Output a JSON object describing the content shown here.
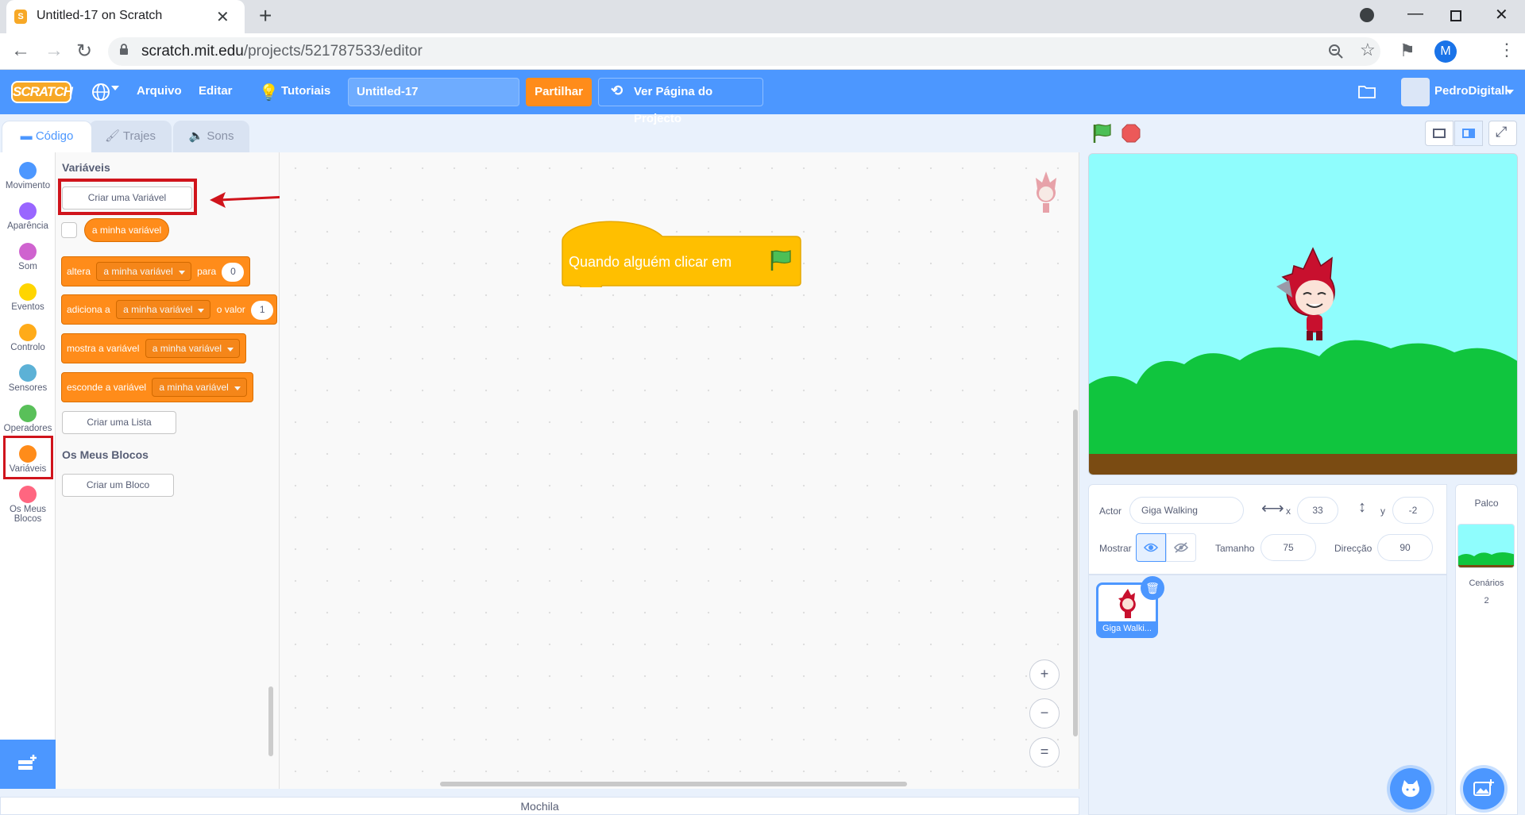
{
  "browser": {
    "tab_title": "Untitled-17 on Scratch",
    "tab_favicon_text": "S",
    "url_domain": "scratch.mit.edu",
    "url_path": "/projects/521787533/editor",
    "profile_initial": "M"
  },
  "menubar": {
    "logo": "SCRATCH",
    "file": "Arquivo",
    "edit": "Editar",
    "tutorials": "Tutoriais",
    "project_title": "Untitled-17",
    "share": "Partilhar",
    "project_page": "Ver Página do Projecto",
    "username": "PedroDigitall"
  },
  "editor_tabs": {
    "code": "Código",
    "costumes": "Trajes",
    "sounds": "Sons"
  },
  "categories": [
    {
      "label": "Movimento",
      "color": "#4c97ff"
    },
    {
      "label": "Aparência",
      "color": "#9966ff"
    },
    {
      "label": "Som",
      "color": "#cf63cf"
    },
    {
      "label": "Eventos",
      "color": "#ffd500"
    },
    {
      "label": "Controlo",
      "color": "#ffab19"
    },
    {
      "label": "Sensores",
      "color": "#5cb1d6"
    },
    {
      "label": "Operadores",
      "color": "#59c059"
    },
    {
      "label": "Variáveis",
      "color": "#ff8c1a"
    },
    {
      "label": "Os Meus Blocos",
      "color": "#ff6680"
    }
  ],
  "palette": {
    "variables_title": "Variáveis",
    "create_variable": "Criar uma Variável",
    "my_variable": "a minha variável",
    "set_block": {
      "prefix": "altera",
      "var": "a minha variável",
      "mid": "para",
      "value": "0"
    },
    "change_block": {
      "prefix": "adiciona a",
      "var": "a minha variável",
      "mid": "o valor",
      "value": "1"
    },
    "show_block": {
      "prefix": "mostra a variável",
      "var": "a minha variável"
    },
    "hide_block": {
      "prefix": "esconde a variável",
      "var": "a minha variável"
    },
    "create_list": "Criar uma Lista",
    "my_blocks_title": "Os Meus Blocos",
    "create_block": "Criar um Bloco"
  },
  "code": {
    "hat_label": "Quando alguém clicar em",
    "zoom_in": "+",
    "zoom_out": "−",
    "zoom_reset": "="
  },
  "backpack": "Mochila",
  "sprite_info": {
    "actor_label": "Actor",
    "actor_name": "Giga Walking",
    "x_label": "x",
    "x_value": "33",
    "y_label": "y",
    "y_value": "-2",
    "show_label": "Mostrar",
    "size_label": "Tamanho",
    "size_value": "75",
    "direction_label": "Direcção",
    "direction_value": "90"
  },
  "sprite_list": [
    {
      "label": "Giga Walki..."
    }
  ],
  "stage_panel": {
    "title": "Palco",
    "backdrops_label": "Cenários",
    "backdrops_count": "2"
  },
  "colors": {
    "scratch_blue": "#4c97ff",
    "variables_orange": "#ff8c1a",
    "events_yellow": "#ffbf00",
    "annotation_red": "#d0141c"
  }
}
